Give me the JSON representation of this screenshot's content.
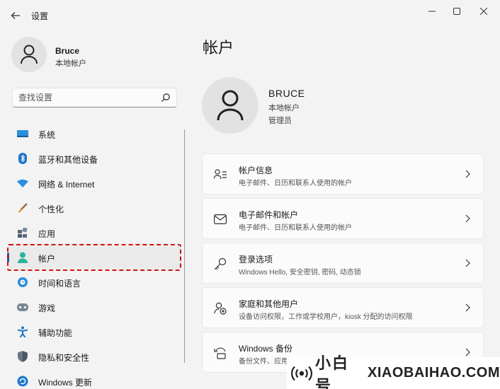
{
  "app": {
    "title": "设置"
  },
  "profile": {
    "name": "Bruce",
    "account_type": "本地帐户"
  },
  "search": {
    "placeholder": "查找设置"
  },
  "nav": {
    "items": [
      {
        "label": "系统",
        "icon": "display-icon"
      },
      {
        "label": "蓝牙和其他设备",
        "icon": "bluetooth-icon"
      },
      {
        "label": "网络 & Internet",
        "icon": "wifi-icon"
      },
      {
        "label": "个性化",
        "icon": "brush-icon"
      },
      {
        "label": "应用",
        "icon": "apps-icon"
      },
      {
        "label": "帐户",
        "icon": "person-icon",
        "selected": true
      },
      {
        "label": "时间和语言",
        "icon": "globe-clock-icon"
      },
      {
        "label": "游戏",
        "icon": "gamepad-icon"
      },
      {
        "label": "辅助功能",
        "icon": "accessibility-icon"
      },
      {
        "label": "隐私和安全性",
        "icon": "shield-icon"
      },
      {
        "label": "Windows 更新",
        "icon": "update-icon"
      }
    ]
  },
  "main": {
    "title": "帐户",
    "hero": {
      "name": "BRUCE",
      "account_type": "本地帐户",
      "role": "管理员"
    },
    "cards": [
      {
        "title": "帐户信息",
        "desc": "电子邮件、日历和联系人使用的帐户",
        "icon": "person-info-icon"
      },
      {
        "title": "电子邮件和帐户",
        "desc": "电子邮件、日历和联系人使用的帐户",
        "icon": "mail-icon"
      },
      {
        "title": "登录选项",
        "desc": "Windows Hello, 安全密钥, 密码, 动态锁",
        "icon": "key-icon"
      },
      {
        "title": "家庭和其他用户",
        "desc": "设备访问权限，工作或学校用户，kiosk 分配的访问权限",
        "icon": "person-add-icon"
      },
      {
        "title": "Windows 备份",
        "desc": "备份文件、应用、首选项",
        "icon": "backup-icon"
      }
    ]
  },
  "watermark": {
    "cn": "小白号",
    "en": "XIAOBAIHAO.COM"
  },
  "colors": {
    "accent": "#0067c0",
    "highlight_border": "#d01010",
    "background": "#f3f3f3",
    "card": "#fbfbfb"
  }
}
